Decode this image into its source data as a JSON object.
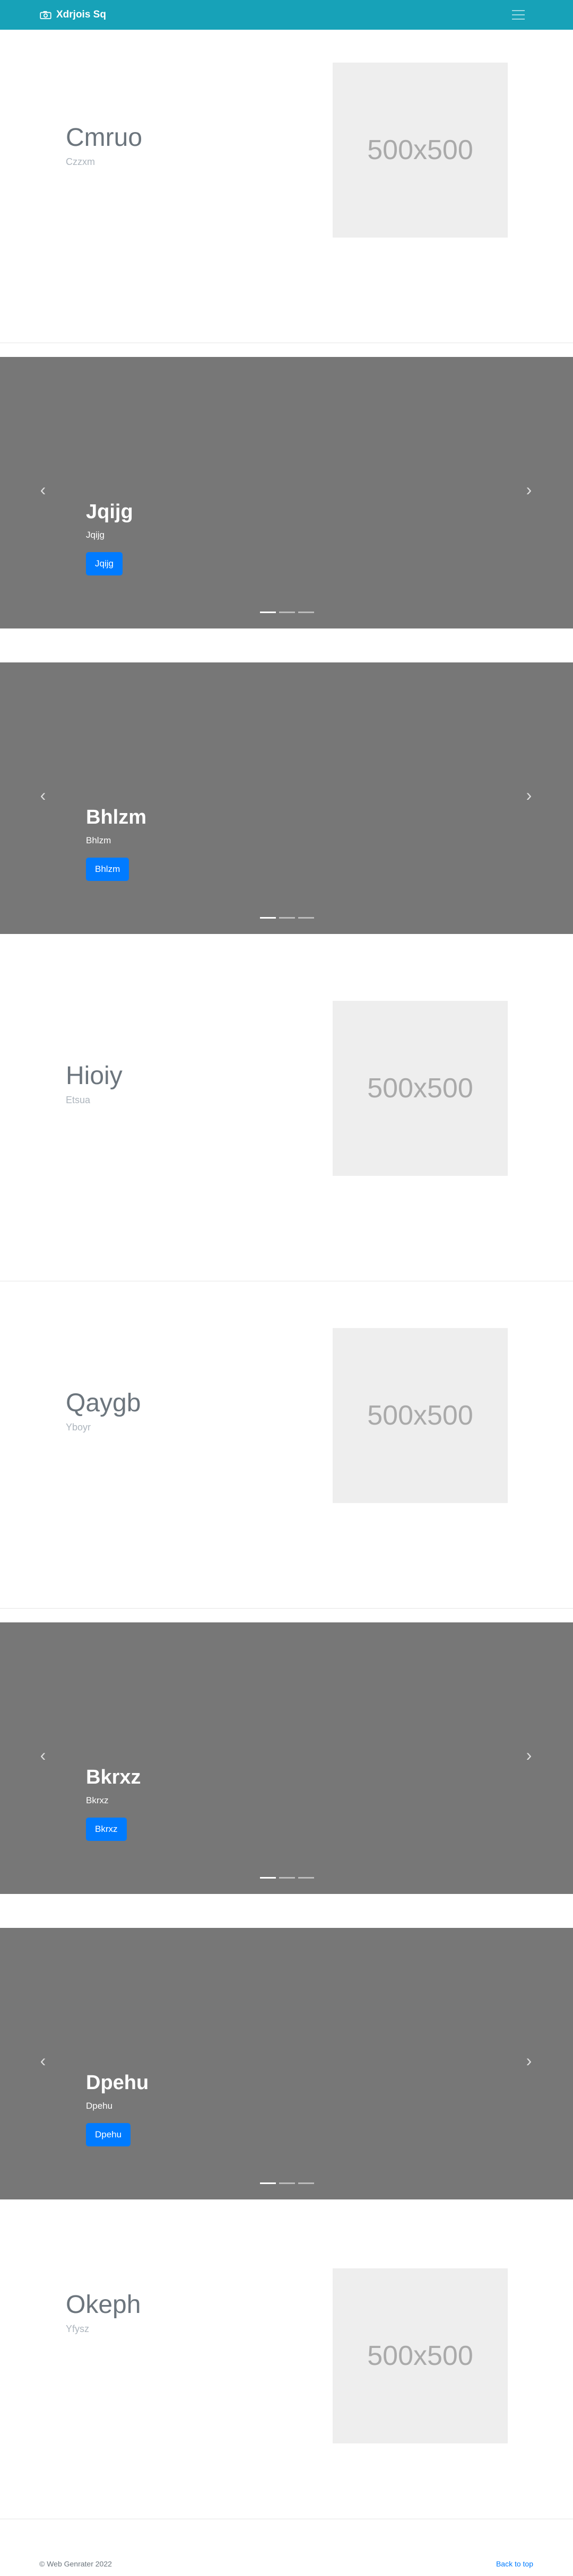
{
  "navbar": {
    "brand": "Xdrjois Sq",
    "brand_icon": "camera-icon",
    "menu_icon": "hamburger-icon"
  },
  "features": [
    {
      "title": "Cmruo",
      "subtitle": "Czzxm",
      "image_label": "500x500"
    },
    {
      "title": "Hioiy",
      "subtitle": "Etsua",
      "image_label": "500x500"
    },
    {
      "title": "Qaygb",
      "subtitle": "Yboyr",
      "image_label": "500x500"
    },
    {
      "title": "Okeph",
      "subtitle": "Yfysz",
      "image_label": "500x500"
    }
  ],
  "carousels": [
    {
      "title": "Jqijg",
      "text": "Jqijg",
      "button": "Jqijg",
      "prev": "‹",
      "next": "›"
    },
    {
      "title": "Bhlzm",
      "text": "Bhlzm",
      "button": "Bhlzm",
      "prev": "‹",
      "next": "›"
    },
    {
      "title": "Bkrxz",
      "text": "Bkrxz",
      "button": "Bkrxz",
      "prev": "‹",
      "next": "›"
    },
    {
      "title": "Dpehu",
      "text": "Dpehu",
      "button": "Dpehu",
      "prev": "‹",
      "next": "›"
    }
  ],
  "footer": {
    "copyright": "© Web Genrater 2022",
    "back_to_top": "Back to top"
  },
  "colors": {
    "navbar": "#17a2b8",
    "carousel_bg": "#777777",
    "button": "#007bff",
    "placeholder": "#eeeeee"
  }
}
